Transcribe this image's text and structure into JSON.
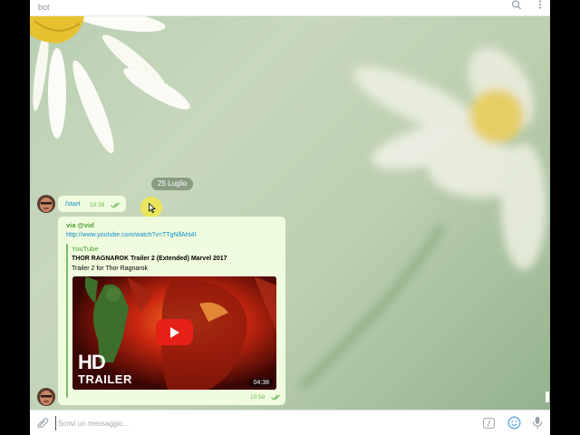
{
  "header": {
    "title": "bot",
    "search_icon": "search-icon",
    "more_icon": "more-vertical-icon"
  },
  "chat": {
    "date_pill": "25 Luglio",
    "messages": [
      {
        "text": "/start",
        "time": "10:39",
        "status_icon": "double-check-icon"
      },
      {
        "via": "via @vid",
        "url": "http://www.youtube.com/watch?v=TTgNlfAht4I",
        "preview": {
          "site": "YouTube",
          "title": "THOR RAGNAROK Trailer 2 (Extended) Marvel 2017",
          "description": "Trailer 2 for Thor Ragnarok",
          "thumb_text_1": "HD",
          "thumb_text_2": "TRAILER",
          "duration": "04:38",
          "play_icon": "play-icon"
        },
        "time": "10:58",
        "status_icon": "double-check-icon"
      }
    ]
  },
  "composer": {
    "placeholder": "Scrivi un messaggio...",
    "attach_icon": "paperclip-icon",
    "command_icon": "slash-command-icon",
    "emoji_icon": "emoji-icon",
    "mic_icon": "microphone-icon"
  },
  "colors": {
    "bubble": "#effdde",
    "link": "#168acd",
    "accent_green": "#4d9e36",
    "play_red": "#e62117"
  }
}
